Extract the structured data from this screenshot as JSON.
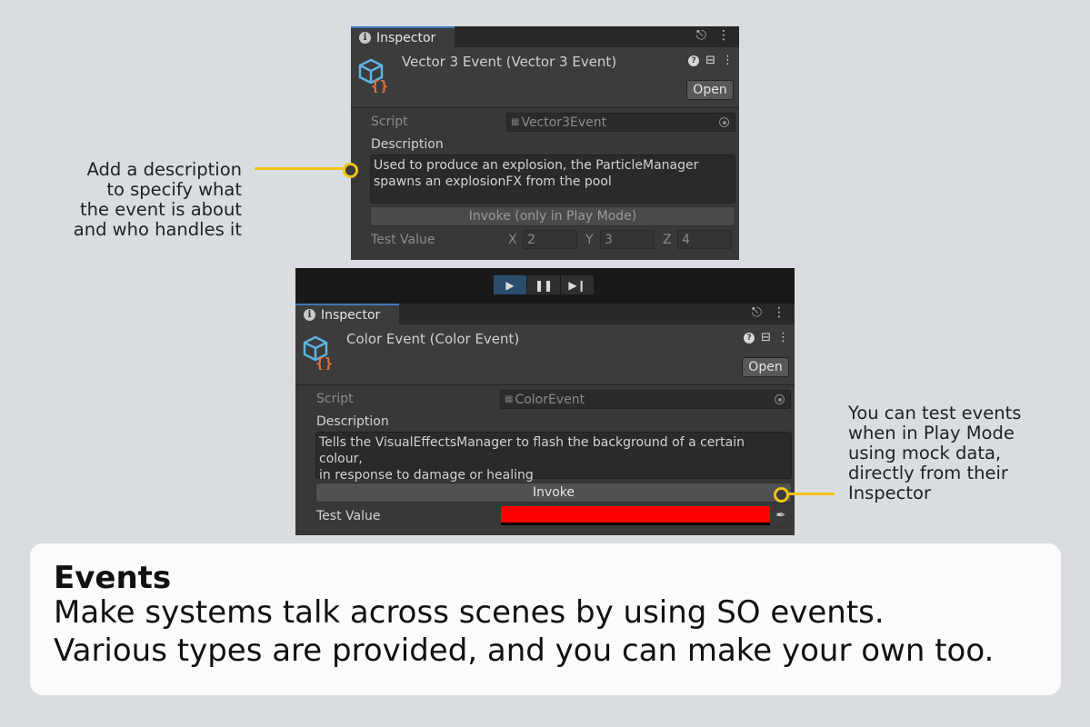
{
  "panel1": {
    "tab_label": "Inspector",
    "asset_title": "Vector 3 Event (Vector 3 Event)",
    "open_label": "Open",
    "script_label": "Script",
    "script_value": "Vector3Event",
    "description_label": "Description",
    "description_lines": [
      "Used to produce an explosion, the ParticleManager",
      "spawns an explosionFX from the pool"
    ],
    "invoke_label": "Invoke (only in Play Mode)",
    "test_value_label": "Test Value",
    "vector": {
      "x_label": "X",
      "x_value": "2",
      "y_label": "Y",
      "y_value": "3",
      "z_label": "Z",
      "z_value": "4"
    }
  },
  "panel2": {
    "tab_label": "Inspector",
    "asset_title": "Color Event (Color Event)",
    "open_label": "Open",
    "script_label": "Script",
    "script_value": "ColorEvent",
    "description_label": "Description",
    "description_lines": [
      "Tells the VisualEffectsManager to flash the background of a certain colour,",
      "in response to damage or healing"
    ],
    "invoke_label": "Invoke",
    "test_value_label": "Test Value",
    "color_value": "#ff0000"
  },
  "annotations": {
    "left_lines": [
      "Add a description",
      "to specify what",
      "the event is about",
      "and who handles it"
    ],
    "right_lines": [
      "You can test events",
      "when in Play Mode",
      "using mock data,",
      "directly from their",
      "Inspector"
    ]
  },
  "caption": {
    "title": "Events",
    "line1": "Make systems talk across scenes by using SO events.",
    "line2": "Various types are provided, and you can make your own too."
  },
  "colors": {
    "accent": "#f2c318",
    "panel_bg": "#383838",
    "swatch": "#ff0000"
  }
}
